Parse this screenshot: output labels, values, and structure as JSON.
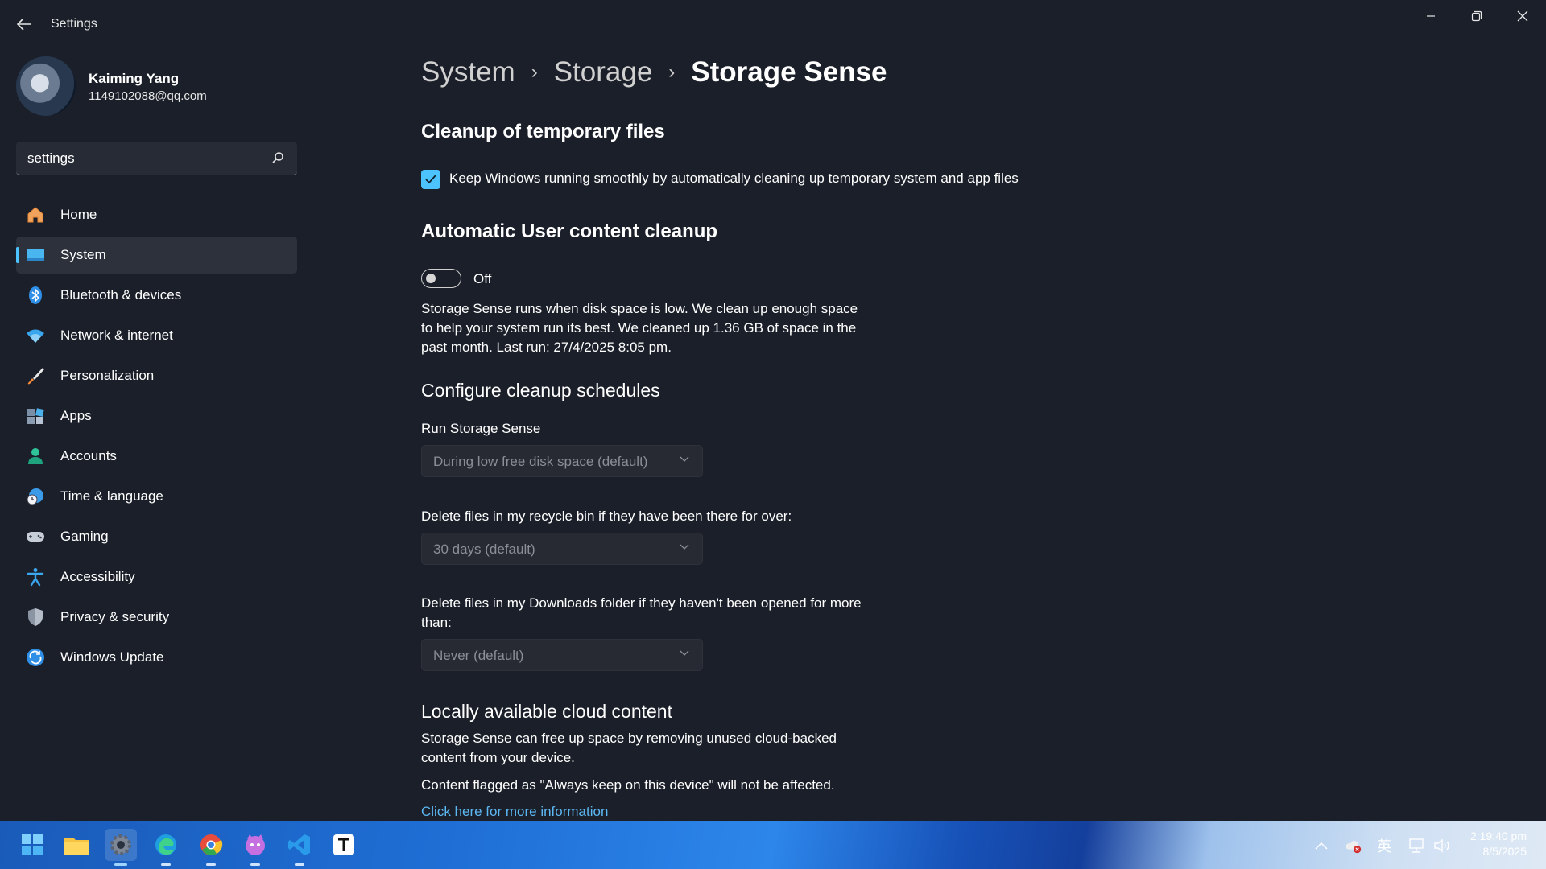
{
  "window": {
    "title": "Settings"
  },
  "profile": {
    "name": "Kaiming Yang",
    "email": "1149102088@qq.com"
  },
  "search": {
    "value": "settings"
  },
  "nav": [
    {
      "label": "Home",
      "icon": "home-icon"
    },
    {
      "label": "System",
      "icon": "monitor-icon",
      "active": true
    },
    {
      "label": "Bluetooth & devices",
      "icon": "bluetooth-icon"
    },
    {
      "label": "Network & internet",
      "icon": "wifi-icon"
    },
    {
      "label": "Personalization",
      "icon": "brush-icon"
    },
    {
      "label": "Apps",
      "icon": "apps-icon"
    },
    {
      "label": "Accounts",
      "icon": "person-icon"
    },
    {
      "label": "Time & language",
      "icon": "clock-globe-icon"
    },
    {
      "label": "Gaming",
      "icon": "gamepad-icon"
    },
    {
      "label": "Accessibility",
      "icon": "accessibility-icon"
    },
    {
      "label": "Privacy & security",
      "icon": "shield-icon"
    },
    {
      "label": "Windows Update",
      "icon": "update-icon"
    }
  ],
  "breadcrumb": {
    "level1": "System",
    "level2": "Storage",
    "current": "Storage Sense"
  },
  "cleanup": {
    "heading": "Cleanup of temporary files",
    "checkbox_label": "Keep Windows running smoothly by automatically cleaning up temporary system and app files",
    "checked": true
  },
  "auto_cleanup": {
    "heading": "Automatic User content cleanup",
    "toggle_label": "Off",
    "description": "Storage Sense runs when disk space is low. We clean up enough space to help your system run its best. We cleaned up 1.36 GB of space in the past month. Last run: 27/4/2025 8:05 pm."
  },
  "schedules": {
    "heading": "Configure cleanup schedules",
    "run_label": "Run Storage Sense",
    "run_value": "During low free disk space (default)",
    "recycle_label": "Delete files in my recycle bin if they have been there for over:",
    "recycle_value": "30 days (default)",
    "downloads_label": "Delete files in my Downloads folder if they haven't been opened for more than:",
    "downloads_value": "Never (default)"
  },
  "cloud": {
    "heading": "Locally available cloud content",
    "description": "Storage Sense can free up space by removing unused cloud-backed content from your device.",
    "note": "Content flagged as \"Always keep on this device\" will not be affected.",
    "link": "Click here for more information"
  },
  "tray": {
    "ime": "英"
  },
  "clock": {
    "time": "2:19:40 pm",
    "date": "8/5/2025"
  },
  "colors": {
    "accent": "#4cc2ff",
    "link": "#5cb8f3",
    "background": "#1b1f29"
  }
}
